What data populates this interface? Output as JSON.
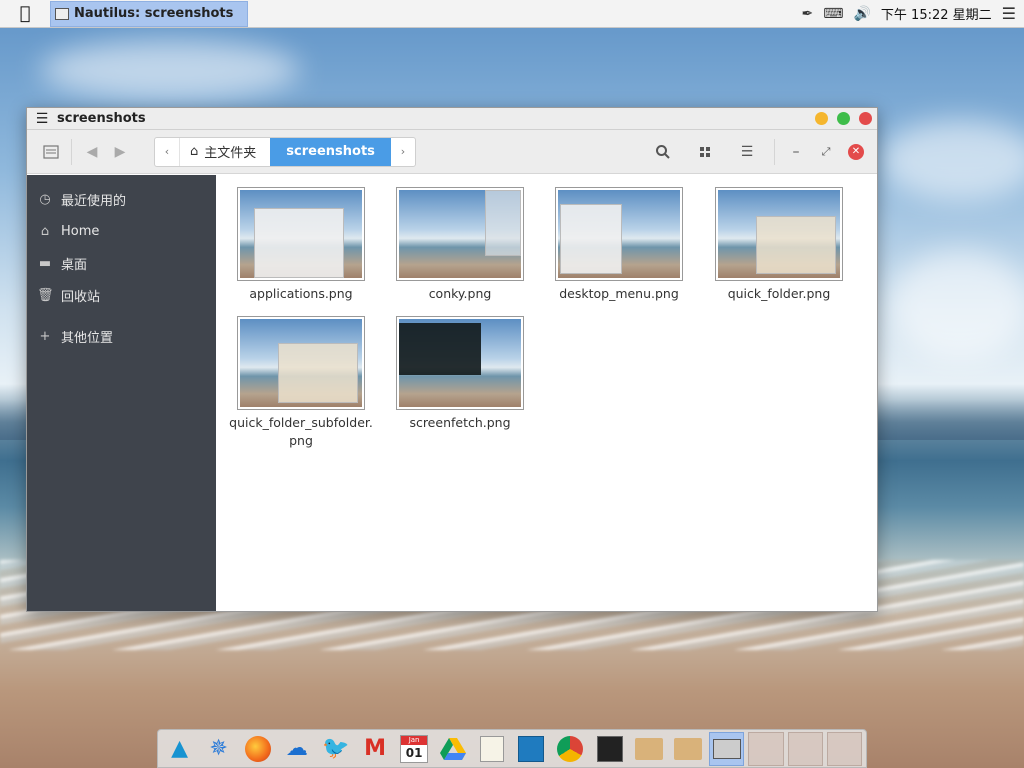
{
  "top_panel": {
    "app_icon": "apple-icon",
    "task_title": "Nautilus: screenshots",
    "clock": "下午 15:22 星期二",
    "tray_icons": [
      "pen-icon",
      "keyboard-icon",
      "volume-icon",
      "menu-icon"
    ]
  },
  "window": {
    "title": "screenshots",
    "pathbar": {
      "home_label": "主文件夹",
      "current_label": "screenshots"
    },
    "sidebar": {
      "items": [
        {
          "icon": "clock-icon",
          "label": "最近使用的"
        },
        {
          "icon": "home-icon",
          "label": "Home"
        },
        {
          "icon": "folder-icon",
          "label": "桌面"
        },
        {
          "icon": "trash-icon",
          "label": "回收站"
        },
        {
          "icon": "plus-icon",
          "label": "其他位置"
        }
      ]
    },
    "files": [
      {
        "name": "applications.png"
      },
      {
        "name": "conky.png"
      },
      {
        "name": "desktop_menu.png"
      },
      {
        "name": "quick_folder.png"
      },
      {
        "name": "quick_folder_subfolder.png"
      },
      {
        "name": "screenfetch.png"
      }
    ]
  },
  "dock": {
    "items": [
      "arch-icon",
      "safari-icon",
      "firefox-icon",
      "onedrive-icon",
      "twitter-icon",
      "gmail-icon",
      "calendar-icon",
      "drive-icon",
      "text-editor-icon",
      "system-monitor-icon",
      "chrome-icon",
      "terminal-icon",
      "home-folder-icon",
      "downloads-icon",
      "window-icon"
    ],
    "calendar_month": "Jan",
    "calendar_day": "01"
  },
  "colors": {
    "accent": "#4a9ce6",
    "sidebar_bg": "#3f444c",
    "close": "#e34b4b",
    "minimize": "#f5b62e",
    "maximize": "#3ebd4a"
  }
}
